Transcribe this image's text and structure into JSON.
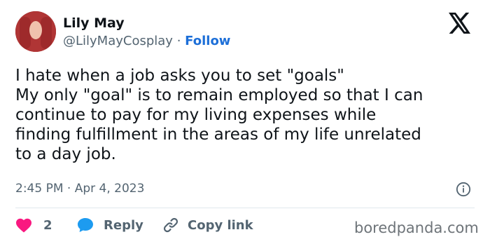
{
  "author": {
    "name": "Lily May",
    "handle": "@LilyMayCosplay",
    "separator": "·",
    "follow_label": "Follow"
  },
  "tweet": {
    "lines": [
      "I hate when a job asks you to set \"goals\"",
      "My only \"goal\" is to remain employed so that I can",
      "continue to pay for my living expenses while",
      "finding fulfillment in the areas of my life unrelated",
      "to a day job."
    ],
    "timestamp": "2:45 PM · Apr 4, 2023"
  },
  "actions": {
    "like_count": "2",
    "reply_label": "Reply",
    "copy_link_label": "Copy link"
  },
  "watermark": "boredpanda.com",
  "colors": {
    "heart": "#f91880",
    "reply_bubble": "#1d9bf0",
    "follow": "#1d6fd8",
    "secondary_text": "#536471"
  },
  "icons": [
    "x-logo-icon",
    "info-icon",
    "heart-icon",
    "reply-bubble-icon",
    "link-icon"
  ]
}
